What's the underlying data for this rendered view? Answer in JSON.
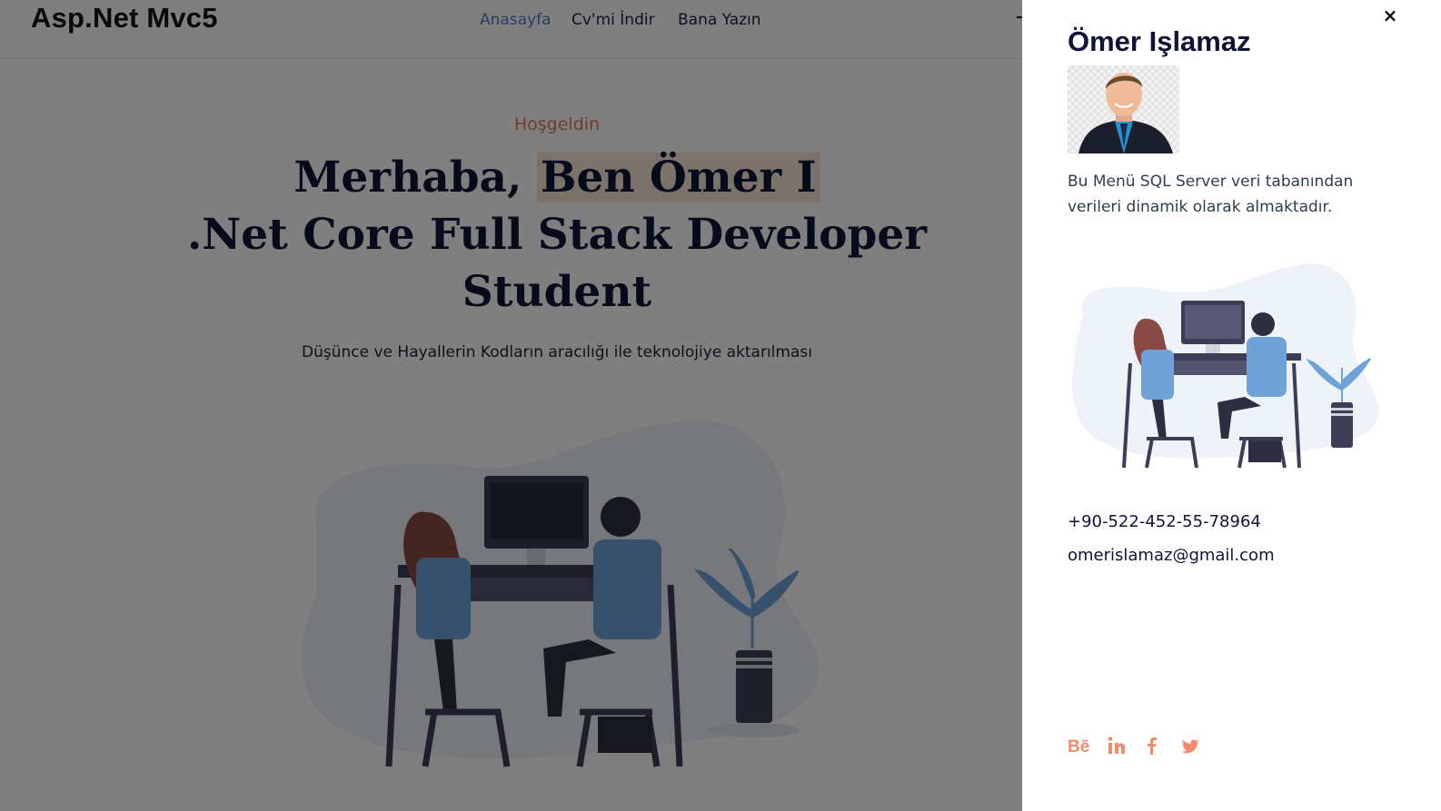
{
  "header": {
    "logo": "Asp.Net Mvc5",
    "nav": [
      {
        "label": "Anasayfa",
        "active": true
      },
      {
        "label": "Cv'mi İndir",
        "active": false
      },
      {
        "label": "Bana Yazın",
        "active": false
      }
    ]
  },
  "hero": {
    "greeting": "Hoşgeldin",
    "headline_static": "Merhaba,",
    "headline_typed": "Ben Ömer I",
    "headline_line2": ".Net Core Full Stack Developer",
    "headline_line3": "Student",
    "lead": "Düşünce ve Hayallerin Kodların aracılığı ile teknolojiye aktarılması"
  },
  "side_panel": {
    "name": "Ömer Işlamaz",
    "description": "Bu Menü SQL Server veri tabanından verileri dinamik olarak almaktadır.",
    "phone": "+90-522-452-55-78964",
    "email": "omerislamaz@gmail.com",
    "close_label": "×",
    "social": [
      {
        "name": "behance",
        "label": "Bē"
      },
      {
        "name": "linkedin",
        "label": "in"
      },
      {
        "name": "facebook",
        "label": "f"
      },
      {
        "name": "twitter",
        "label": "twitter"
      }
    ]
  },
  "colors": {
    "accent": "#e07a5f",
    "nav_active": "#4a7bbd",
    "heading": "#0f1437",
    "social": "#f08c6b",
    "overlay": "rgba(0,0,0,0.5)"
  }
}
